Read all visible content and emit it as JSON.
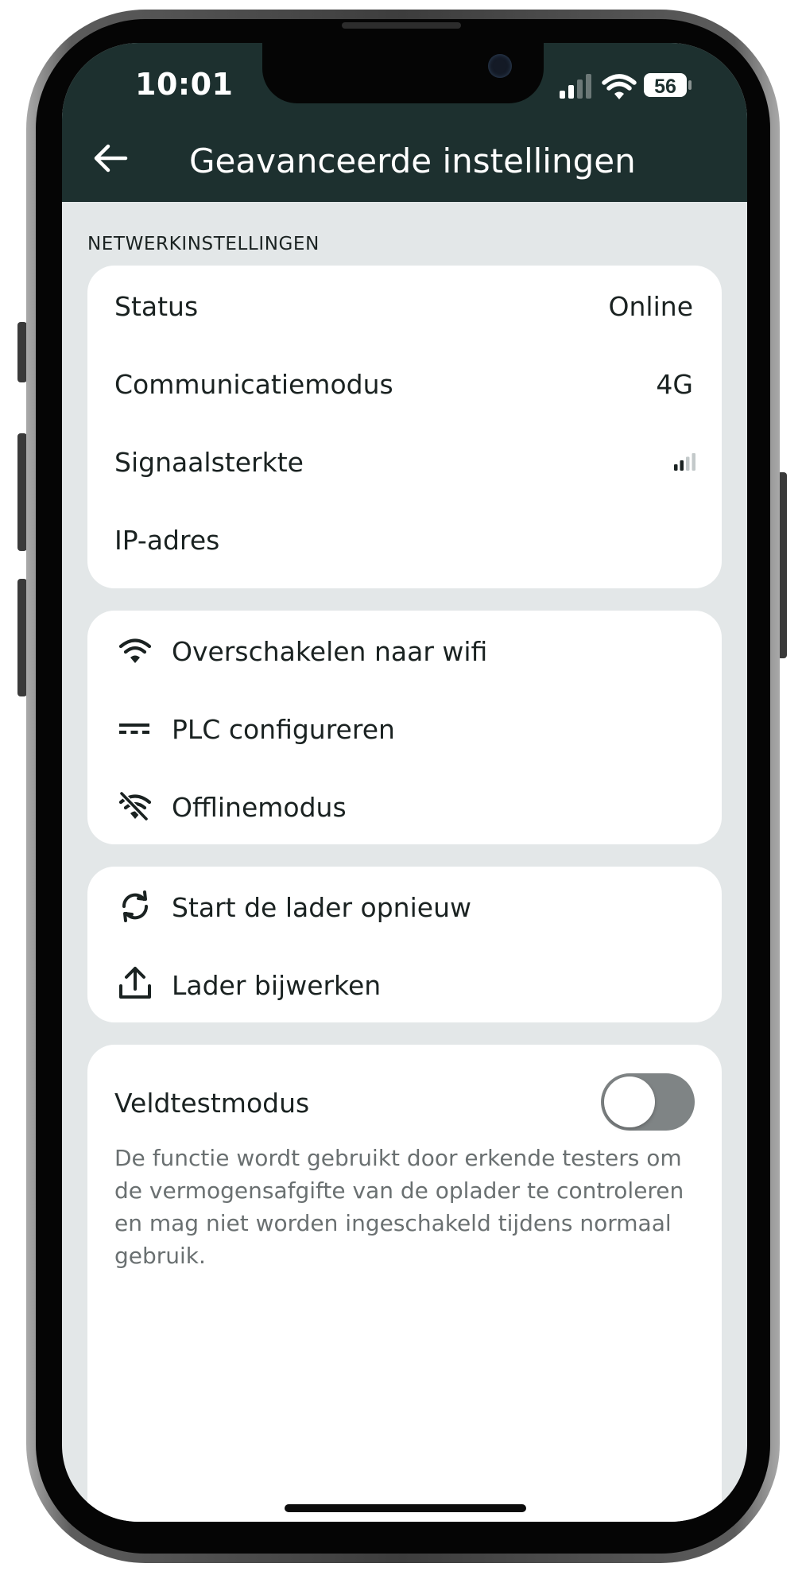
{
  "status_bar": {
    "time": "10:01",
    "battery": "56"
  },
  "header": {
    "title": "Geavanceerde instellingen"
  },
  "network": {
    "section_label": "NETWERKINSTELLINGEN",
    "rows": [
      {
        "label": "Status",
        "value": "Online"
      },
      {
        "label": "Communicatiemodus",
        "value": "4G"
      },
      {
        "label": "Signaalsterkte",
        "value": ""
      },
      {
        "label": "IP-adres",
        "value": ""
      }
    ],
    "signal_bars": 2
  },
  "connection_actions": [
    {
      "label": "Overschakelen naar wifi",
      "icon": "wifi-icon"
    },
    {
      "label": "PLC configureren",
      "icon": "plc-icon"
    },
    {
      "label": "Offlinemodus",
      "icon": "wifi-off-icon"
    }
  ],
  "charger_actions": [
    {
      "label": "Start de lader opnieuw",
      "icon": "restart-icon"
    },
    {
      "label": "Lader bijwerken",
      "icon": "upload-icon"
    }
  ],
  "field_test": {
    "label": "Veldtestmodus",
    "enabled": false,
    "description": "De functie wordt gebruikt door erkende testers om de vermogensafgifte van de oplader te controleren en mag niet worden ingeschakeld tijdens normaal gebruik."
  },
  "colors": {
    "header_bg": "#1d302f",
    "screen_bg": "#e3e7e8",
    "card_bg": "#ffffff",
    "text": "#1a2221",
    "muted_text": "#6a7071",
    "toggle_off": "#7f8485"
  }
}
